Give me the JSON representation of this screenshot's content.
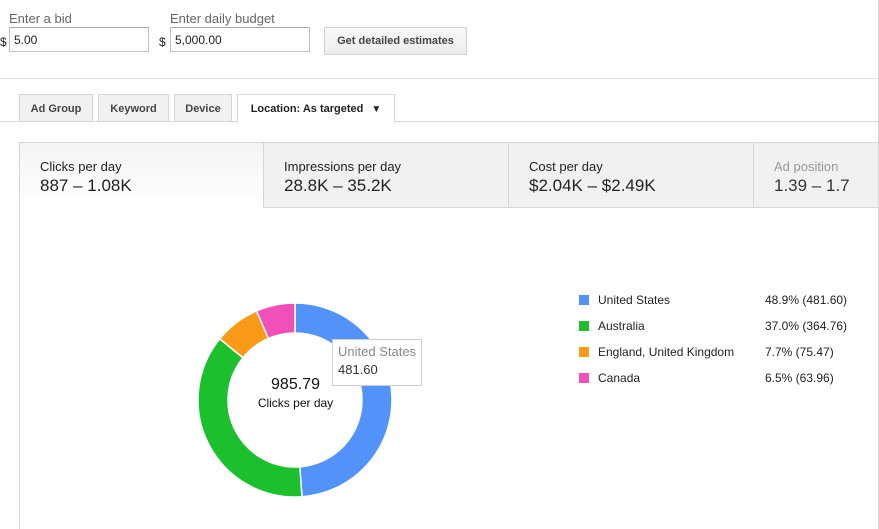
{
  "bid": {
    "label": "Enter a bid",
    "currency": "$",
    "value": "5.00"
  },
  "budget": {
    "label": "Enter daily budget",
    "currency": "$",
    "value": "5,000.00"
  },
  "estimate_button": "Get detailed estimates",
  "tabs": [
    {
      "label": "Ad Group"
    },
    {
      "label": "Keyword"
    },
    {
      "label": "Device"
    },
    {
      "label": "Location: As targeted",
      "arrow": "▼"
    }
  ],
  "metrics": [
    {
      "title": "Clicks per day",
      "value": "887 – 1.08K"
    },
    {
      "title": "Impressions per day",
      "value": "28.8K – 35.2K"
    },
    {
      "title": "Cost per day",
      "value": "$2.04K – $2.49K"
    },
    {
      "title": "Ad position",
      "value": "1.39 – 1.7"
    }
  ],
  "donut": {
    "total": "985.79",
    "total_label": "Clicks per day",
    "tooltip": {
      "name": "United States",
      "value": "481.60"
    }
  },
  "legend": [
    {
      "name": "United States",
      "pct": "48.9% (481.60)",
      "color": "#5193f8"
    },
    {
      "name": "Australia",
      "pct": "37.0% (364.76)",
      "color": "#1cbf2c"
    },
    {
      "name": "England, United Kingdom",
      "pct": "7.7% (75.47)",
      "color": "#fb9a18"
    },
    {
      "name": "Canada",
      "pct": "6.5% (63.96)",
      "color": "#f050b8"
    }
  ],
  "chart_data": {
    "type": "pie",
    "categories": [
      "United States",
      "Australia",
      "England, United Kingdom",
      "Canada"
    ],
    "values": [
      481.6,
      364.76,
      75.47,
      63.96
    ],
    "percentages": [
      48.9,
      37.0,
      7.7,
      6.5
    ],
    "colors": [
      "#5193f8",
      "#1cbf2c",
      "#fb9a18",
      "#f050b8"
    ],
    "title": "",
    "legend": "right"
  }
}
